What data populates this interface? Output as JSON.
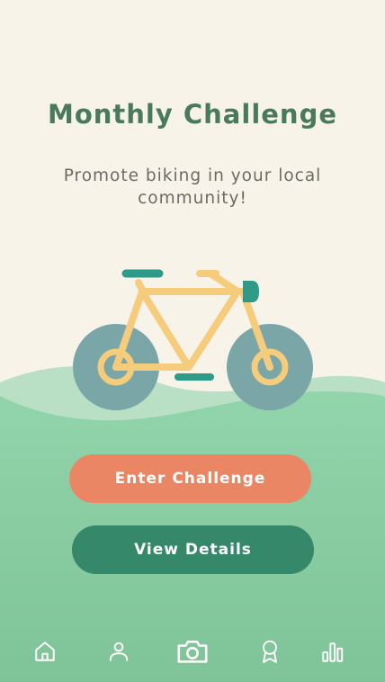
{
  "hero": {
    "title": "Monthly Challenge",
    "subtitle": "Promote biking in your local community!"
  },
  "actions": {
    "primary_label": "Enter Challenge",
    "secondary_label": "View Details"
  },
  "tab_bar": {
    "items": [
      {
        "icon": "home-icon"
      },
      {
        "icon": "profile-icon"
      },
      {
        "icon": "camera-icon"
      },
      {
        "icon": "award-icon"
      },
      {
        "icon": "stats-icon"
      }
    ]
  },
  "colors": {
    "background": "#f7f3e9",
    "title": "#4a7a5c",
    "subtitle": "#6b6b66",
    "primary_button": "#ea8664",
    "secondary_button": "#358869",
    "hill_light": "#b9e0c5",
    "hill": "#8ccfa5",
    "bike_frame": "#f4cc7c",
    "bike_wheel": "#7aa6a8",
    "bike_accent": "#2e9a88",
    "tab_icon": "#ffffff"
  }
}
